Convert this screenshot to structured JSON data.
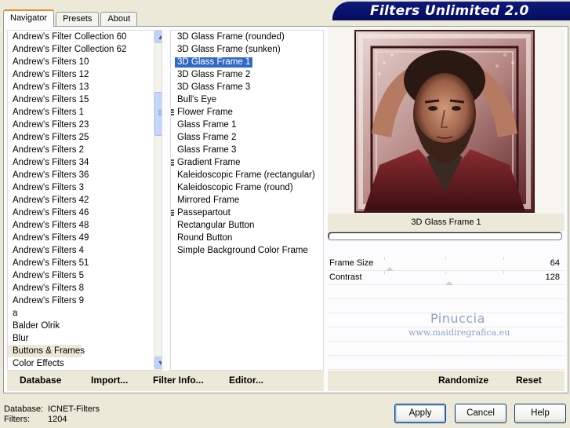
{
  "tabs": [
    "Navigator",
    "Presets",
    "About"
  ],
  "banner_title": "Filters Unlimited 2.0",
  "categories": [
    "Andrew's Filter Collection 60",
    "Andrew's Filter Collection 62",
    "Andrew's Filters 10",
    "Andrew's Filters 12",
    "Andrew's Filters 13",
    "Andrew's Filters 15",
    "Andrew's Filters 1",
    "Andrew's Filters 23",
    "Andrew's Filters 25",
    "Andrew's Filters 2",
    "Andrew's Filters 34",
    "Andrew's Filters 36",
    "Andrew's Filters 3",
    "Andrew's Filters 42",
    "Andrew's Filters 46",
    "Andrew's Filters 48",
    "Andrew's Filters 49",
    "Andrew's Filters 4",
    "Andrew's Filters 51",
    "Andrew's Filters 5",
    "Andrew's Filters 8",
    "Andrew's Filters 9",
    "a",
    "Balder Olrik",
    "Blur",
    "Buttons & Frames",
    "Color Effects"
  ],
  "selected_category": "Buttons & Frames",
  "filters": [
    {
      "label": "3D Glass Frame (rounded)",
      "group": false
    },
    {
      "label": "3D Glass Frame (sunken)",
      "group": false
    },
    {
      "label": "3D Glass Frame 1",
      "group": false
    },
    {
      "label": "3D Glass Frame 2",
      "group": false
    },
    {
      "label": "3D Glass Frame 3",
      "group": false
    },
    {
      "label": "Bull's Eye",
      "group": false
    },
    {
      "label": "Flower Frame",
      "group": true
    },
    {
      "label": "Glass Frame 1",
      "group": false
    },
    {
      "label": "Glass Frame 2",
      "group": false
    },
    {
      "label": "Glass Frame 3",
      "group": false
    },
    {
      "label": "Gradient Frame",
      "group": true
    },
    {
      "label": "Kaleidoscopic Frame (rectangular)",
      "group": false
    },
    {
      "label": "Kaleidoscopic Frame (round)",
      "group": false
    },
    {
      "label": "Mirrored Frame",
      "group": false
    },
    {
      "label": "Passepartout",
      "group": true
    },
    {
      "label": "Rectangular Button",
      "group": false
    },
    {
      "label": "Round Button",
      "group": false
    },
    {
      "label": "Simple Background Color Frame",
      "group": false
    }
  ],
  "selected_filter": "3D Glass Frame 1",
  "preview_title": "3D Glass Frame 1",
  "progress": 0,
  "params": [
    {
      "label": "Frame Size",
      "value": "64",
      "fraction": 0.25
    },
    {
      "label": "Contrast",
      "value": "128",
      "fraction": 0.5
    }
  ],
  "watermark": {
    "name": "Pinuccia",
    "site": "www.maidiregrafica.eu"
  },
  "left_buttons": {
    "database": "Database",
    "import": "Import...",
    "filter_info": "Filter Info...",
    "editor": "Editor..."
  },
  "right_buttons": {
    "randomize": "Randomize",
    "reset": "Reset"
  },
  "footer": {
    "database_label": "Database:",
    "database_value": "ICNET-Filters",
    "filters_label": "Filters:",
    "filters_value": "1204"
  },
  "dialog_buttons": {
    "apply": "Apply",
    "cancel": "Cancel",
    "help": "Help"
  },
  "icons": {
    "scroll_up": "arrow-up-icon",
    "scroll_down": "arrow-down-icon"
  },
  "colors": {
    "banner": "#07126b",
    "selection": "#316ac5",
    "tab_highlight": "#e68b2c"
  }
}
